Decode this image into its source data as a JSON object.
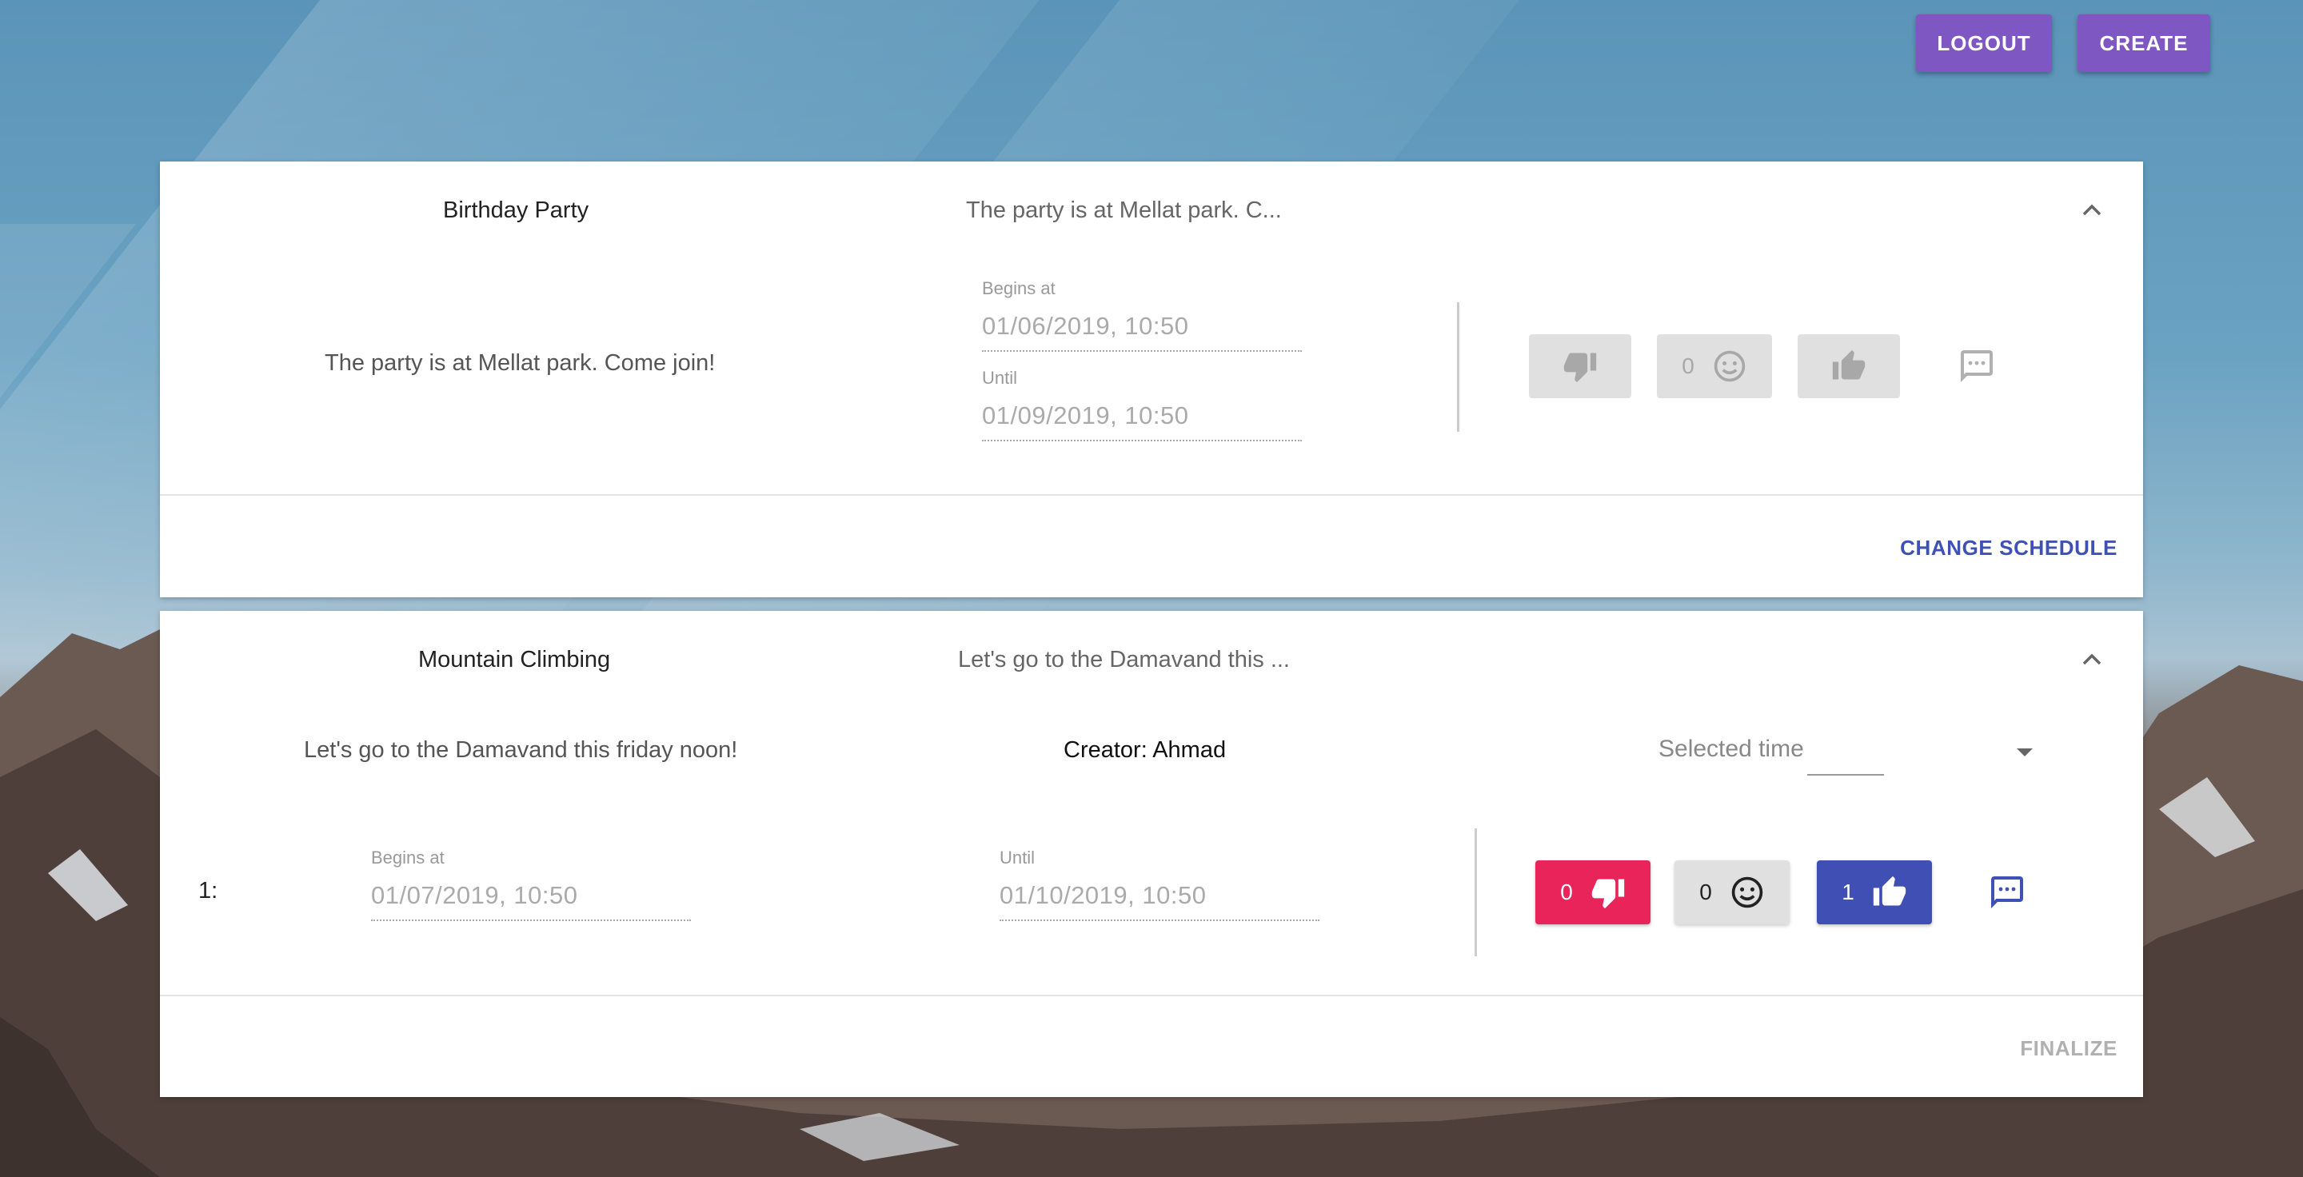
{
  "header": {
    "logout_label": "LOGOUT",
    "create_label": "CREATE"
  },
  "events": [
    {
      "title": "Birthday Party",
      "summary": "The party is at Mellat park. C...",
      "description": "The party is at Mellat park. Come join!",
      "begins_label": "Begins at",
      "begins_value": "01/06/2019, 10:50",
      "until_label": "Until",
      "until_value": "01/09/2019, 10:50",
      "neutral_count": "0",
      "action_label": "CHANGE SCHEDULE"
    },
    {
      "title": "Mountain Climbing",
      "summary": "Let's go to the Damavand this ...",
      "description": "Let's go to the Damavand this friday noon!",
      "creator": "Creator: Ahmad",
      "selected_time_placeholder": "Selected time",
      "schedules": [
        {
          "index": "1:",
          "begins_label": "Begins at",
          "begins_value": "01/07/2019, 10:50",
          "until_label": "Until",
          "until_value": "01/10/2019, 10:50",
          "dislike_count": "0",
          "neutral_count": "0",
          "like_count": "1"
        }
      ],
      "action_label": "FINALIZE"
    }
  ],
  "colors": {
    "primary_purple": "#7e57c2",
    "indigo": "#3f51b5",
    "pink": "#e8245b",
    "disabled_grey": "#e0e0e0"
  },
  "icons": [
    "thumb-down-icon",
    "smiley-icon",
    "thumb-up-icon",
    "comment-icon",
    "chevron-up-icon",
    "dropdown-arrow-icon"
  ]
}
